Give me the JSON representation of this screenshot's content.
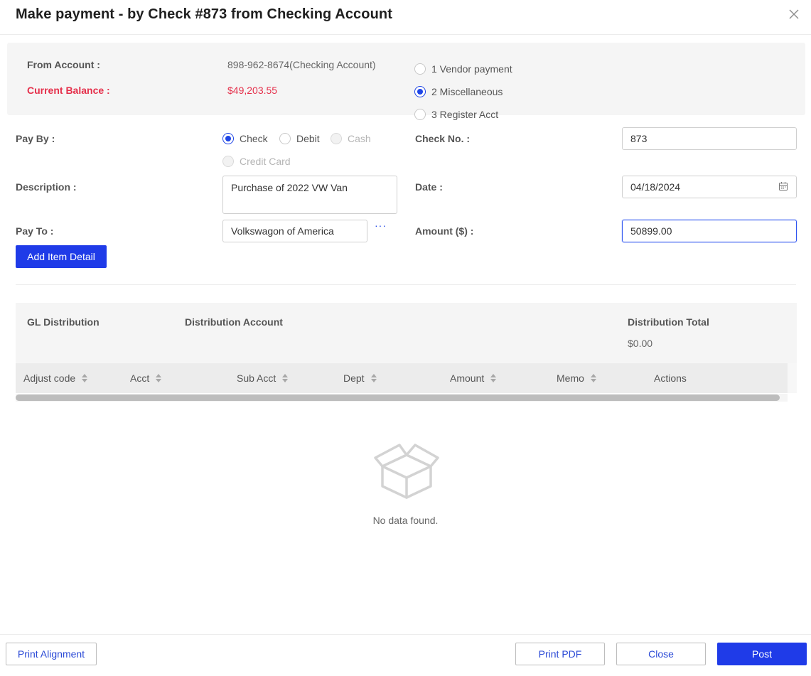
{
  "dialog": {
    "title": "Make payment - by Check #873 from Checking Account"
  },
  "summary": {
    "from_account_label": "From Account :",
    "from_account_value": "898-962-8674(Checking Account)",
    "current_balance_label": "Current Balance :",
    "current_balance_value": "$49,203.55",
    "payment_types": [
      {
        "label": "1 Vendor payment",
        "checked": false
      },
      {
        "label": "2 Miscellaneous",
        "checked": true
      },
      {
        "label": "3 Register Acct",
        "checked": false
      }
    ]
  },
  "form": {
    "pay_by_label": "Pay By :",
    "pay_by_options": [
      {
        "label": "Check",
        "checked": true,
        "disabled": false
      },
      {
        "label": "Debit",
        "checked": false,
        "disabled": false
      },
      {
        "label": "Cash",
        "checked": false,
        "disabled": true
      },
      {
        "label": "Credit Card",
        "checked": false,
        "disabled": true
      }
    ],
    "check_no_label": "Check No. :",
    "check_no_value": "873",
    "description_label": "Description :",
    "description_value": "Purchase of 2022 VW Van",
    "date_label": "Date :",
    "date_value": "04/18/2024",
    "pay_to_label": "Pay To :",
    "pay_to_value": "Volkswagon of America",
    "pay_to_more": "···",
    "amount_label": "Amount ($) :",
    "amount_value": "50899.00",
    "add_item_label": "Add Item Detail"
  },
  "gl": {
    "distribution_label": "GL Distribution",
    "account_label": "Distribution Account",
    "total_label": "Distribution Total",
    "total_value": "$0.00"
  },
  "table": {
    "columns": [
      "Adjust code",
      "Acct",
      "Sub Acct",
      "Dept",
      "Amount",
      "Memo",
      "Actions"
    ],
    "empty_text": "No data found."
  },
  "footer": {
    "print_alignment": "Print Alignment",
    "print_pdf": "Print PDF",
    "close": "Close",
    "post": "Post"
  },
  "colors": {
    "primary": "#1f3be8",
    "danger": "#e5304b",
    "panel": "#f5f5f5"
  },
  "icons": {
    "close": "close-icon",
    "calendar": "calendar-icon",
    "sort": "sort-icon",
    "empty": "empty-box-icon"
  }
}
